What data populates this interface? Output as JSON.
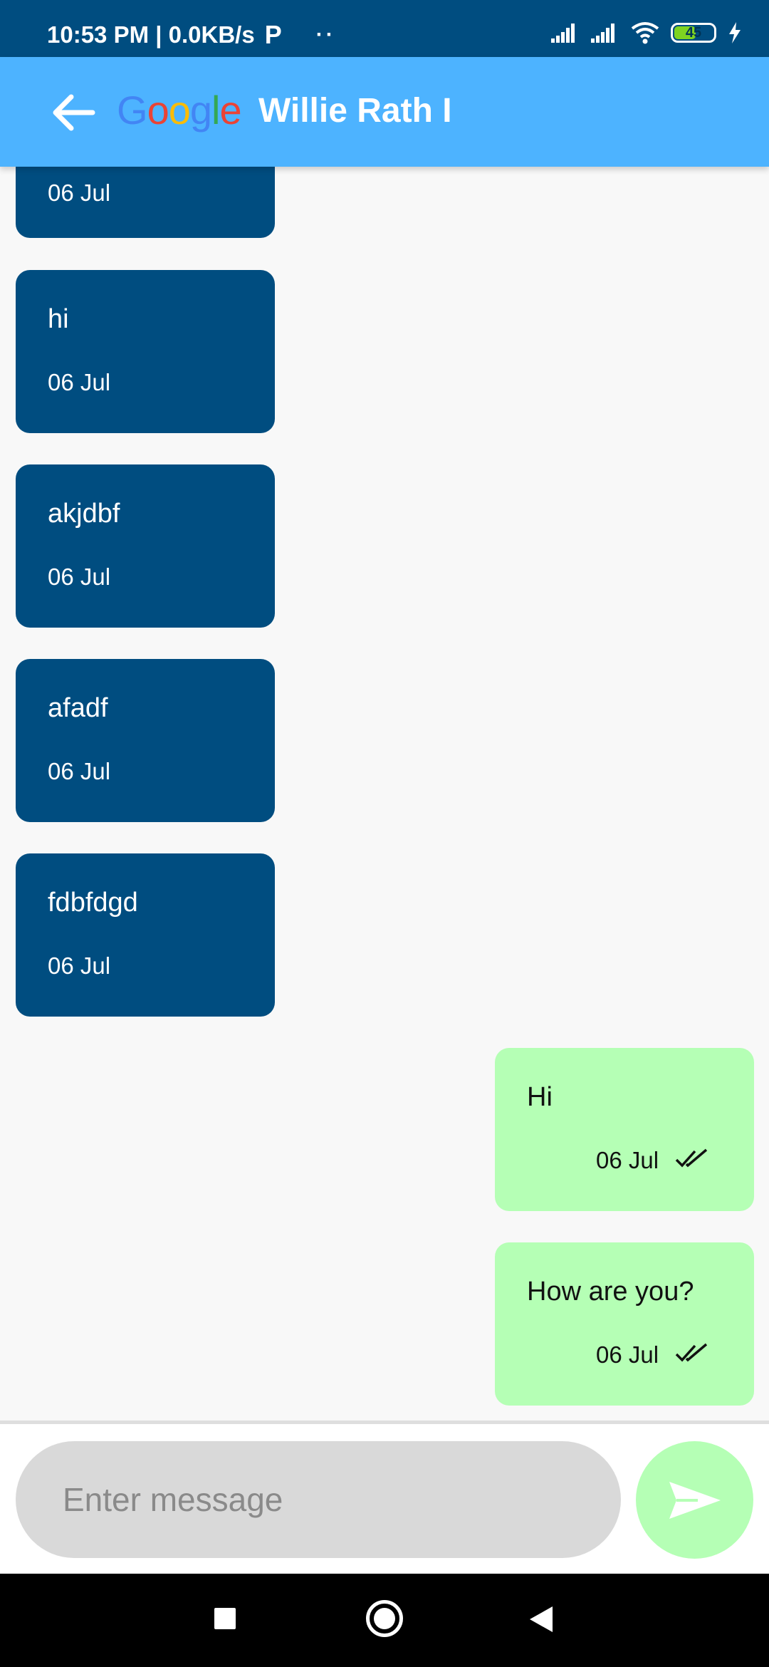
{
  "status_bar": {
    "time_speed": "10:53 PM | 0.0KB/s",
    "p_icon": "P",
    "dots": "··",
    "battery_level": "45"
  },
  "app_bar": {
    "logo_letters": [
      "G",
      "o",
      "o",
      "g",
      "l",
      "e"
    ],
    "title": "Willie Rath I"
  },
  "messages": [
    {
      "direction": "incoming",
      "text": "",
      "date": "06 Jul"
    },
    {
      "direction": "incoming",
      "text": "hi",
      "date": "06 Jul"
    },
    {
      "direction": "incoming",
      "text": "akjdbf",
      "date": "06 Jul"
    },
    {
      "direction": "incoming",
      "text": "afadf",
      "date": "06 Jul"
    },
    {
      "direction": "incoming",
      "text": "fdbfdgd",
      "date": "06 Jul"
    },
    {
      "direction": "outgoing",
      "text": "Hi",
      "date": "06 Jul",
      "read": true
    },
    {
      "direction": "outgoing",
      "text": "How are you?",
      "date": "06 Jul",
      "read": true
    }
  ],
  "composer": {
    "value": "",
    "placeholder": "Enter message",
    "send_icon": "send-icon"
  },
  "colors": {
    "status_bar": "#004d80",
    "app_bar": "#4db3ff",
    "incoming_bubble": "#004d80",
    "outgoing_bubble": "#b5ffb5",
    "input_bg": "#d9d9d9",
    "send_button": "#b5ffb5"
  }
}
